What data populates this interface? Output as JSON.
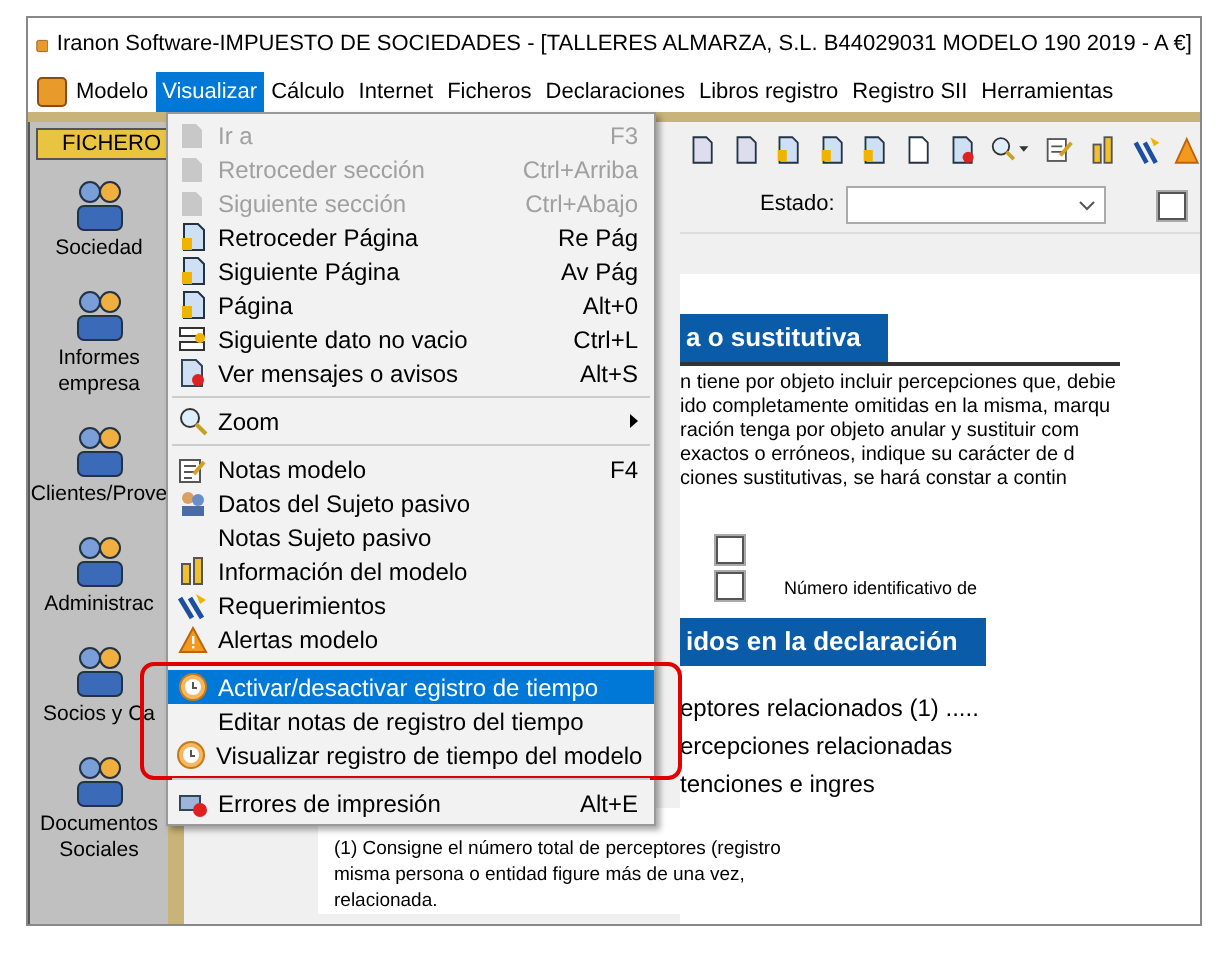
{
  "window": {
    "title": "Iranon Software-IMPUESTO DE SOCIEDADES - [TALLERES ALMARZA, S.L. B44029031  MODELO 190  2019 - A €]"
  },
  "menu_bar": [
    {
      "label": "Modelo",
      "selected": false
    },
    {
      "label": "Visualizar",
      "selected": true
    },
    {
      "label": "Cálculo",
      "selected": false
    },
    {
      "label": "Internet",
      "selected": false
    },
    {
      "label": "Ficheros",
      "selected": false
    },
    {
      "label": "Declaraciones",
      "selected": false
    },
    {
      "label": "Libros registro",
      "selected": false
    },
    {
      "label": "Registro SII",
      "selected": false
    },
    {
      "label": "Herramientas",
      "selected": false
    }
  ],
  "sidebar": {
    "tab": "FICHERO",
    "items": [
      {
        "label": "Sociedad"
      },
      {
        "label": "Informes empresa"
      },
      {
        "label": "Clientes/Prove"
      },
      {
        "label": "Administrac"
      },
      {
        "label": "Socios y Ca"
      },
      {
        "label": "Documentos Sociales"
      }
    ]
  },
  "dropdown_menu": {
    "groups": [
      {
        "marked": false,
        "items": [
          {
            "label": "Ir a",
            "shortcut": "F3",
            "disabled": true,
            "selected": false
          },
          {
            "label": "Retroceder sección",
            "shortcut": "Ctrl+Arriba",
            "disabled": true,
            "selected": false
          },
          {
            "label": "Siguiente sección",
            "shortcut": "Ctrl+Abajo",
            "disabled": true,
            "selected": false
          },
          {
            "label": "Retroceder Página",
            "shortcut": "Re Pág",
            "disabled": false,
            "selected": false
          },
          {
            "label": "Siguiente Página",
            "shortcut": "Av Pág",
            "disabled": false,
            "selected": false
          },
          {
            "label": "Página",
            "shortcut": "Alt+0",
            "disabled": false,
            "selected": false
          },
          {
            "label": "Siguiente dato no vacio",
            "shortcut": "Ctrl+L",
            "disabled": false,
            "selected": false
          },
          {
            "label": "Ver mensajes o avisos",
            "shortcut": "Alt+S",
            "disabled": false,
            "selected": false
          }
        ]
      },
      {
        "marked": false,
        "items": [
          {
            "label": "Zoom",
            "submenu": true,
            "disabled": false,
            "selected": false
          }
        ]
      },
      {
        "marked": false,
        "items": [
          {
            "label": "Notas modelo",
            "shortcut": "F4",
            "disabled": false,
            "selected": false
          },
          {
            "label": "Datos del Sujeto pasivo",
            "disabled": false,
            "selected": false
          },
          {
            "label": "Notas Sujeto pasivo",
            "disabled": false,
            "selected": false
          },
          {
            "label": "Información del modelo",
            "disabled": false,
            "selected": false
          },
          {
            "label": "Requerimientos",
            "disabled": false,
            "selected": false
          },
          {
            "label": "Alertas modelo",
            "disabled": false,
            "selected": false
          }
        ]
      },
      {
        "marked": true,
        "items": [
          {
            "label": "Activar/desactivar egistro de tiempo",
            "disabled": false,
            "selected": true
          },
          {
            "label": "Editar notas de registro del tiempo",
            "disabled": false,
            "selected": false
          },
          {
            "label": "Visualizar registro de tiempo del modelo",
            "disabled": false,
            "selected": false
          }
        ]
      },
      {
        "marked": false,
        "items": [
          {
            "label": "Errores de impresión",
            "shortcut": "Alt+E",
            "disabled": false,
            "selected": false
          }
        ]
      }
    ]
  },
  "filter": {
    "label": "Estado:",
    "checkbox_checked": false
  },
  "document": {
    "section_1": "a o sustitutiva",
    "paragraph_lines": [
      "n tiene por objeto incluir percepciones que, debie",
      "ido completamente omitidas en la misma, marqu",
      "ración tenga por objeto anular y sustituir com",
      "exactos o erróneos, indique su carácter de d",
      "ciones sustitutivas, se hará constar a contin"
    ],
    "checkboxes": [
      {
        "checked": false
      },
      {
        "checked": false
      }
    ],
    "id_label": "Número identificativo de",
    "section_2": "idos en la declaración",
    "rows": [
      "eptores relacionados (1) .....",
      "ercepciones relacionadas",
      "tenciones e ingres"
    ],
    "footnote_lines": [
      "(1) Consigne el número total de perceptores (registro",
      "misma persona o entidad figure más de una vez,",
      "relacionada."
    ]
  }
}
